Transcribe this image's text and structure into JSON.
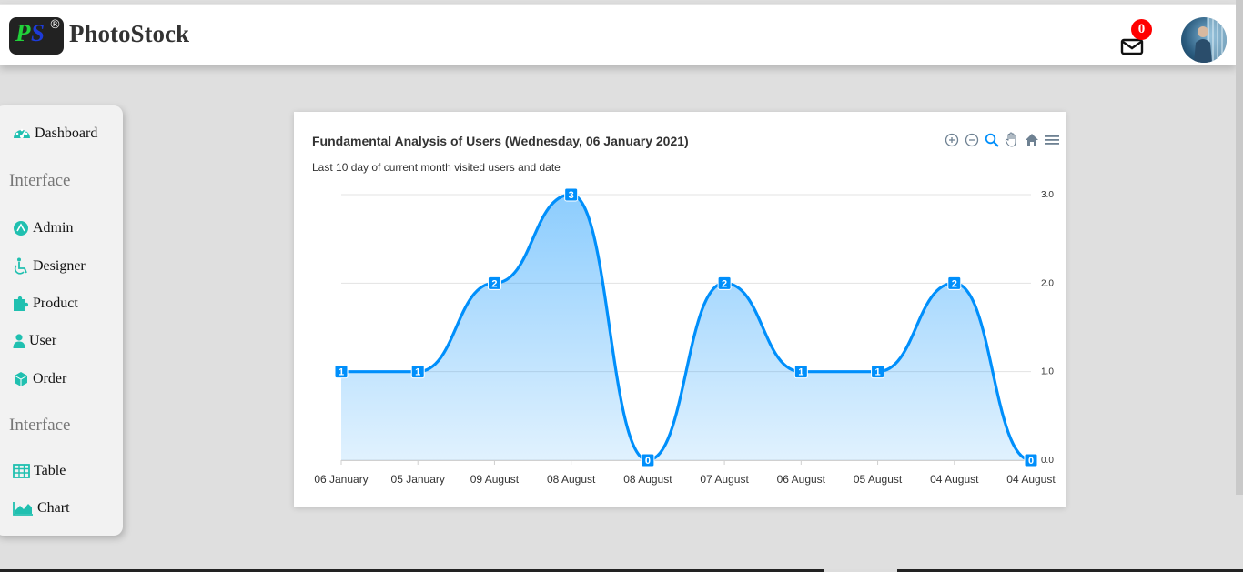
{
  "header": {
    "logo_letter_p": "P",
    "logo_letter_s": "S",
    "logo_registered": "®",
    "brand": "PhotoStock",
    "mail_count": "0"
  },
  "sidebar": {
    "dashboard": "Dashboard",
    "section1": "Interface",
    "admin": "Admin",
    "designer": "Designer",
    "product": "Product",
    "user": "User",
    "order": "Order",
    "section2": "Interface",
    "table": "Table",
    "chart": "Chart"
  },
  "colors": {
    "accent": "#008ffb",
    "icon_teal": "#20c0b0",
    "badge": "#ff0000"
  },
  "chart_data": {
    "type": "area",
    "title": "Fundamental Analysis of Users (Wednesday, 06 January 2021)",
    "subtitle": "Last 10 day of current month visited users and date",
    "categories": [
      "06 January",
      "05 January",
      "09 August",
      "08 August",
      "08 August",
      "07 August",
      "06 August",
      "05 August",
      "04 August",
      "04 August"
    ],
    "series": [
      {
        "values": [
          1,
          1,
          2,
          3,
          0,
          2,
          1,
          1,
          2,
          0
        ]
      }
    ],
    "ylim": [
      0,
      3
    ],
    "yticks": [
      "0.0",
      "1.0",
      "2.0",
      "3.0"
    ],
    "yaxis_position": "right",
    "grid": true,
    "curve": "smooth",
    "data_labels": true
  }
}
